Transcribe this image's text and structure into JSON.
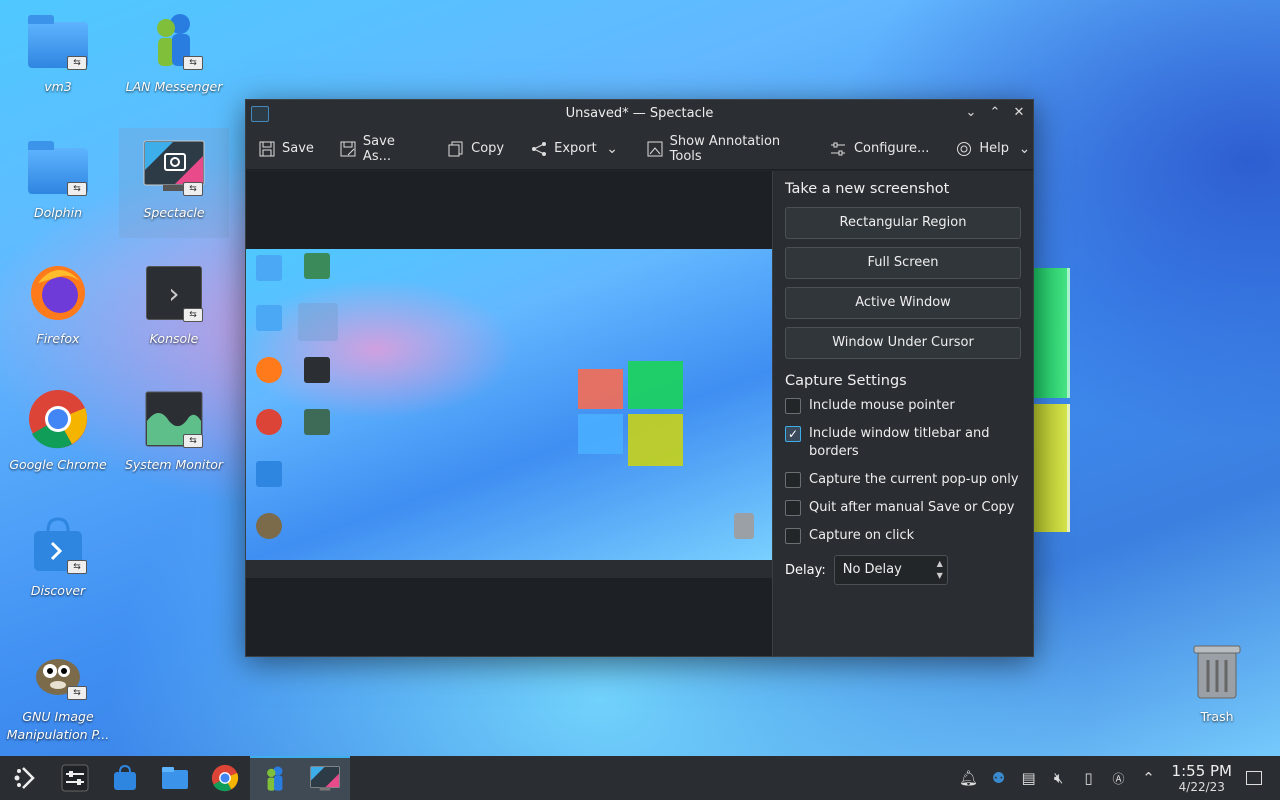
{
  "desktop": {
    "icons": [
      {
        "label": "vm3"
      },
      {
        "label": "LAN Messenger"
      },
      {
        "label": "Dolphin"
      },
      {
        "label": "Spectacle"
      },
      {
        "label": "Firefox"
      },
      {
        "label": "Konsole"
      },
      {
        "label": "Google Chrome"
      },
      {
        "label": "System Monitor"
      },
      {
        "label": "Discover"
      },
      {
        "label": "GNU Image Manipulation P..."
      },
      {
        "label": "Trash"
      }
    ]
  },
  "window": {
    "title": "Unsaved* — Spectacle",
    "toolbar": {
      "save": "Save",
      "save_as": "Save As...",
      "copy": "Copy",
      "export": "Export",
      "annotation": "Show Annotation Tools",
      "configure": "Configure...",
      "help": "Help"
    },
    "take_heading": "Take a new screenshot",
    "capture_buttons": [
      "Rectangular Region",
      "Full Screen",
      "Active Window",
      "Window Under Cursor"
    ],
    "settings_heading": "Capture Settings",
    "options": [
      {
        "label": "Include mouse pointer",
        "checked": false
      },
      {
        "label": "Include window titlebar and borders",
        "checked": true
      },
      {
        "label": "Capture the current pop-up only",
        "checked": false
      },
      {
        "label": "Quit after manual Save or Copy",
        "checked": false
      },
      {
        "label": "Capture on click",
        "checked": false
      }
    ],
    "delay_label": "Delay:",
    "delay_value": "No Delay"
  },
  "taskbar": {
    "time": "1:55 PM",
    "date": "4/22/23"
  },
  "colors": {
    "accent": "#3daee9",
    "window_bg": "#232629",
    "panel_bg": "#2a2e32"
  }
}
